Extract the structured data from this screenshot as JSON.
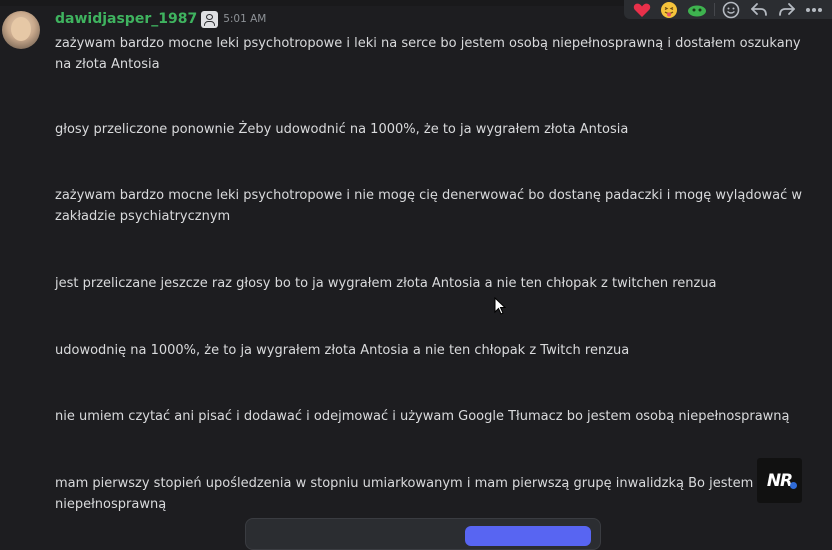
{
  "message": {
    "username": "dawidjasper_1987",
    "timestamp": "5:01 AM",
    "paragraphs": [
      "zażywam bardzo mocne leki psychotropowe i leki na serce bo jestem osobą niepełnosprawną i dostałem oszukany na złota Antosia",
      "głosy przeliczone ponownie Żeby udowodnić na 1000%, że to ja wygrałem złota Antosia",
      "zażywam bardzo mocne leki psychotropowe i nie mogę cię denerwować bo dostanę padaczki i mogę wylądować w zakładzie psychiatrycznym",
      "jest przeliczane jeszcze raz głosy bo to ja wygrałem złota Antosia a nie ten chłopak z twitchen renzua",
      "udowodnię na 1000%, że to ja wygrałem złota Antosia a nie ten chłopak z Twitch  renzua",
      "nie umiem czytać ani pisać i dodawać i odejmować i używam Google Tłumacz bo jestem osobą niepełnosprawną",
      "mam pierwszy stopień upośledzenia w stopniu umiarkowanym i mam pierwszą grupę inwalidzką Bo jestem osobą niepełnosprawną"
    ]
  },
  "toolbar": {
    "icons": [
      "heart-reaction-icon",
      "grin-tongue-reaction-icon",
      "green-blob-reaction-icon",
      "add-reaction-icon",
      "reply-icon",
      "forward-icon",
      "more-options-icon"
    ]
  },
  "watermark": {
    "text": "NR"
  },
  "colors": {
    "background": "#1d1d20",
    "username": "#3fb35f",
    "text": "#d9dadc",
    "timestamp": "#8e9297",
    "toolbar": "#2b2d31",
    "accent": "#5865f2"
  }
}
